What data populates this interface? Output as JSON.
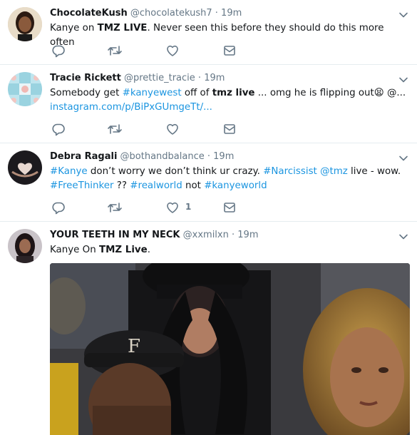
{
  "tweets": [
    {
      "name": "ChocolateKush",
      "handle": "@chocolatekush7",
      "dot": "·",
      "time": "19m",
      "text_a": "Kanye on ",
      "text_b": "TMZ LIVE",
      "text_c": ". Never seen this before they should do this more often"
    },
    {
      "name": "Tracie Rickett",
      "handle": "@prettie_tracie",
      "dot": "·",
      "time": "19m",
      "text_a": "Somebody get ",
      "text_b": "#kanyewest",
      "text_c": " off of ",
      "text_d": "tmz live",
      "text_e": " ... omg he is flipping out",
      "emoji": "😫",
      "text_f": " @...",
      "link": "instagram.com/p/BiPxGUmgeTt/..."
    },
    {
      "name": "Debra Ragali",
      "handle": "@bothandbalance",
      "dot": "·",
      "time": "19m",
      "l1_a": "#Kanye",
      "l1_b": " don’t worry we don’t think ur crazy. ",
      "l1_c": "#Narcissist",
      "l1_d": " ",
      "l1_e": "@tmz",
      "l1_f": " live - wow.",
      "l2_a": "#FreeThinker",
      "l2_b": " ?? ",
      "l2_c": "#realworld",
      "l2_d": " not ",
      "l2_e": "#kanyeworld",
      "like_count": "1"
    },
    {
      "name": "YOUR TEETH IN MY NECK",
      "handle": "@xxmilxn",
      "dot": "·",
      "time": "19m",
      "text_a": "Kanye On ",
      "text_b": "TMZ Live",
      "text_c": "."
    }
  ],
  "icons": {
    "reply": "reply-icon",
    "retweet": "retweet-icon",
    "like": "heart-icon",
    "dm": "envelope-icon",
    "more": "chevron-down-icon"
  },
  "colors": {
    "link": "#1b95e0",
    "muted": "#657786",
    "icon": "#657786"
  }
}
